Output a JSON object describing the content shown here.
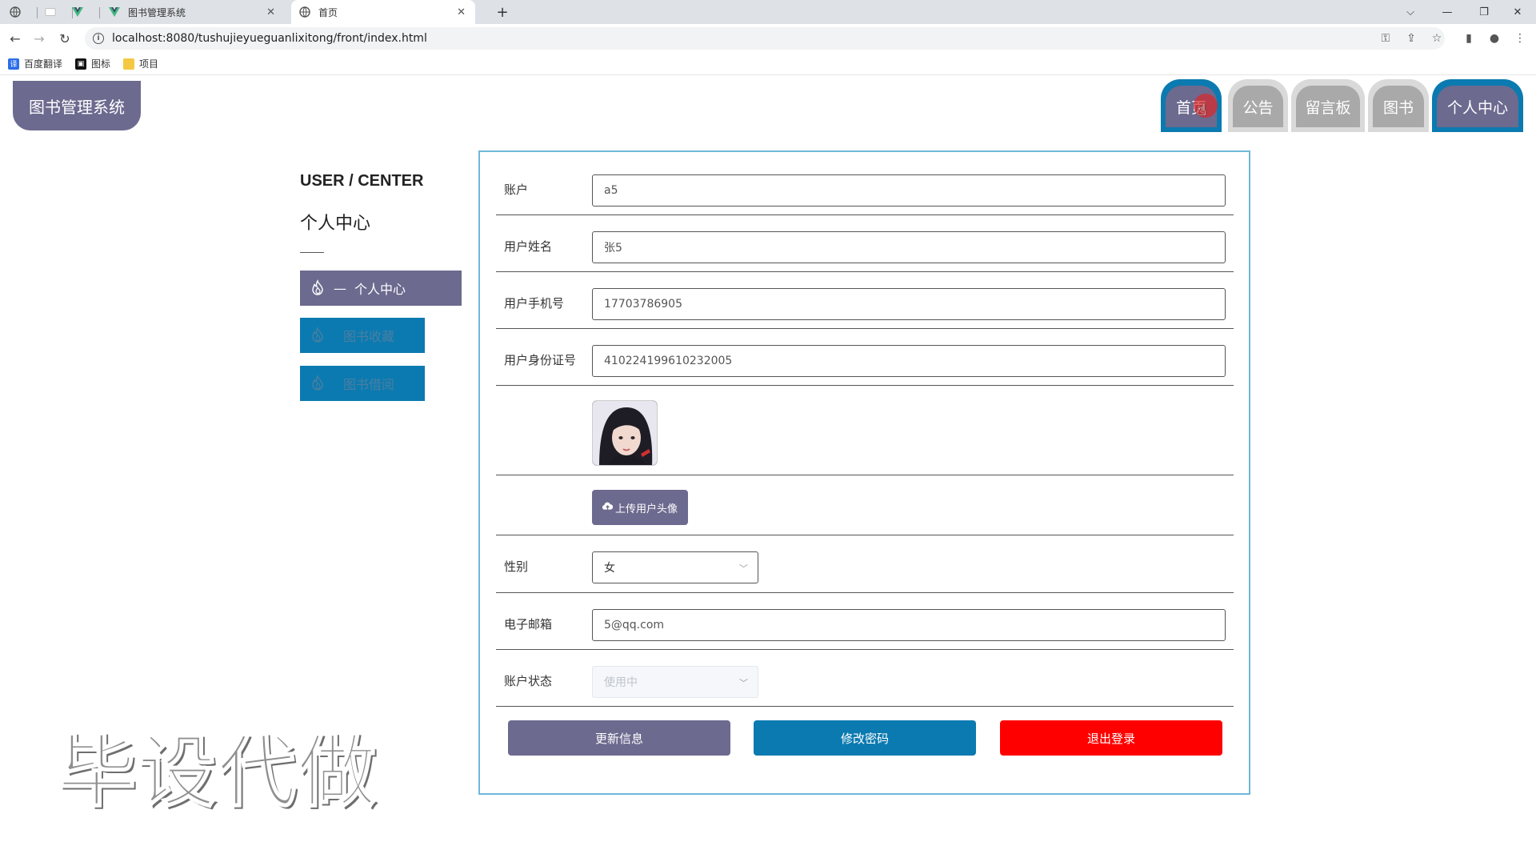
{
  "browser": {
    "tabs": [
      {
        "title": ""
      },
      {
        "title": ""
      },
      {
        "title": ""
      },
      {
        "title": "图书管理系统"
      },
      {
        "title": "首页"
      }
    ],
    "new_tab_glyph": "+",
    "url": "localhost:8080/tushujieyueguanlixitong/front/index.html",
    "bookmarks": [
      {
        "label": "百度翻译"
      },
      {
        "label": "图标"
      },
      {
        "label": "项目"
      }
    ]
  },
  "header": {
    "logo_text": "图书管理系统",
    "nav": {
      "home": "首页",
      "notice": "公告",
      "message_board": "留言板",
      "books": "图书",
      "user_center": "个人中心"
    }
  },
  "sidebar": {
    "title_en": "USER / CENTER",
    "title_cn": "个人中心",
    "items": [
      {
        "label": "个人中心",
        "dash": "—",
        "active": true
      },
      {
        "label": "图书收藏",
        "active": false
      },
      {
        "label": "图书借阅",
        "active": false
      }
    ]
  },
  "form": {
    "account": {
      "label": "账户",
      "value": "a5"
    },
    "name": {
      "label": "用户姓名",
      "value": "张5"
    },
    "phone": {
      "label": "用户手机号",
      "value": "17703786905"
    },
    "id_card": {
      "label": "用户身份证号",
      "value": "410224199610232005"
    },
    "upload_label": "上传用户头像",
    "gender": {
      "label": "性别",
      "value": "女"
    },
    "email": {
      "label": "电子邮箱",
      "value": "5@qq.com"
    },
    "status": {
      "label": "账户状态",
      "value": "使用中"
    },
    "buttons": {
      "update": "更新信息",
      "change_password": "修改密码",
      "logout": "退出登录"
    }
  },
  "watermark": "毕设代做",
  "colors": {
    "primary": "#6c6a8f",
    "secondary": "#0b7ab0",
    "danger": "#ff0000",
    "nav_gray": "#a9a9a9"
  }
}
